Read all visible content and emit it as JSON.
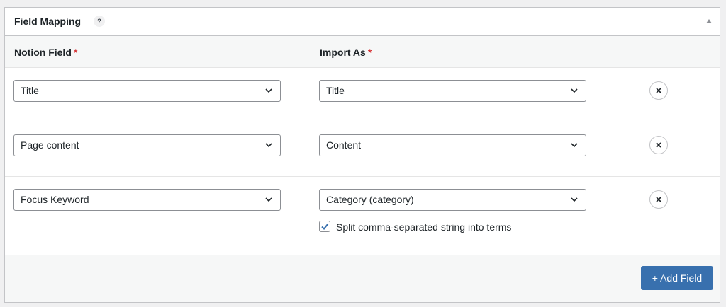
{
  "panel": {
    "title": "Field Mapping",
    "help": "?"
  },
  "columns": {
    "notion_field": "Notion Field",
    "import_as": "Import As",
    "required_mark": "*"
  },
  "rows": [
    {
      "notion_field": "Title",
      "import_as": "Title"
    },
    {
      "notion_field": "Page content",
      "import_as": "Content"
    },
    {
      "notion_field": "Focus Keyword",
      "import_as": "Category (category)",
      "split_terms": {
        "label": "Split comma-separated string into terms",
        "checked": true
      }
    }
  ],
  "footer": {
    "add_label": "+ Add Field"
  },
  "colors": {
    "accent": "#3870ae",
    "required": "#d63638",
    "check": "#3870ae"
  }
}
